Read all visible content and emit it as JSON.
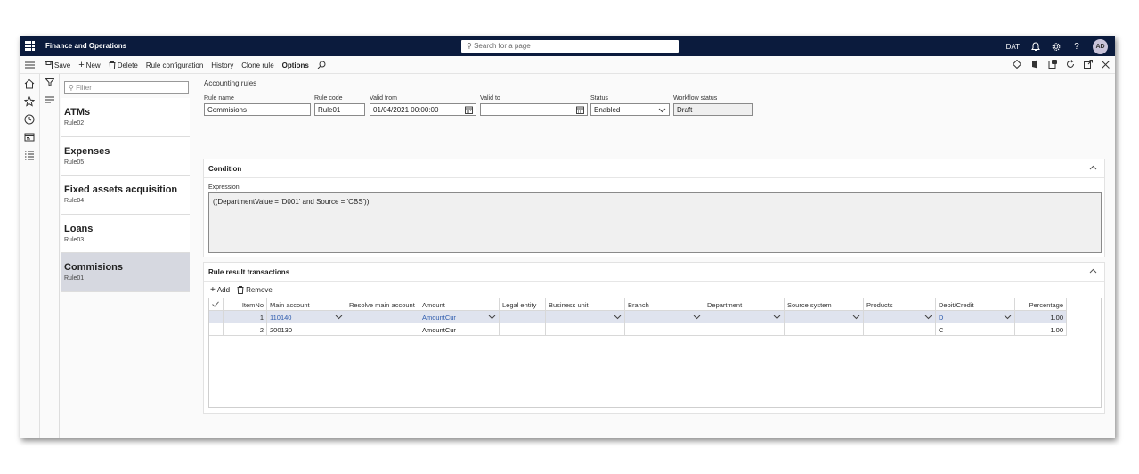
{
  "app": {
    "title": "Finance and Operations",
    "search_placeholder": "Search for a page",
    "company": "DAT",
    "user_initials": "AD"
  },
  "actions": {
    "save": "Save",
    "new": "New",
    "delete": "Delete",
    "rule_configuration": "Rule configuration",
    "history": "History",
    "clone_rule": "Clone rule",
    "options": "Options"
  },
  "list": {
    "filter_placeholder": "Filter",
    "items": [
      {
        "name": "ATMs",
        "code": "Rule02"
      },
      {
        "name": "Expenses",
        "code": "Rule05"
      },
      {
        "name": "Fixed assets acquisition",
        "code": "Rule04"
      },
      {
        "name": "Loans",
        "code": "Rule03"
      },
      {
        "name": "Commisions",
        "code": "Rule01"
      }
    ]
  },
  "page": {
    "title": "Accounting rules"
  },
  "header_fields": {
    "rule_name": {
      "label": "Rule name",
      "value": "Commisions"
    },
    "rule_code": {
      "label": "Rule code",
      "value": "Rule01"
    },
    "valid_from": {
      "label": "Valid from",
      "value": "01/04/2021 00:00:00"
    },
    "valid_to": {
      "label": "Valid to",
      "value": ""
    },
    "status": {
      "label": "Status",
      "value": "Enabled"
    },
    "workflow_status": {
      "label": "Workflow status",
      "value": "Draft"
    }
  },
  "condition": {
    "title": "Condition",
    "expression_label": "Expression",
    "expression": "((DepartmentValue = 'D001' and Source = 'CBS'))"
  },
  "transactions": {
    "title": "Rule result transactions",
    "add": "Add",
    "remove": "Remove",
    "columns": [
      "ItemNo",
      "Main account",
      "Resolve main account",
      "Amount",
      "Legal entity",
      "Business unit",
      "Branch",
      "Department",
      "Source system",
      "Products",
      "Debit/Credit",
      "Percentage"
    ],
    "rows": [
      {
        "item_no": "1",
        "main_account": "110140",
        "resolve": "",
        "amount": "AmountCur",
        "legal_entity": "",
        "business_unit": "",
        "branch": "",
        "department": "",
        "source_system": "",
        "products": "",
        "debit_credit": "D",
        "percentage": "1.00"
      },
      {
        "item_no": "2",
        "main_account": "200130",
        "resolve": "",
        "amount": "AmountCur",
        "legal_entity": "",
        "business_unit": "",
        "branch": "",
        "department": "",
        "source_system": "",
        "products": "",
        "debit_credit": "C",
        "percentage": "1.00"
      }
    ]
  }
}
